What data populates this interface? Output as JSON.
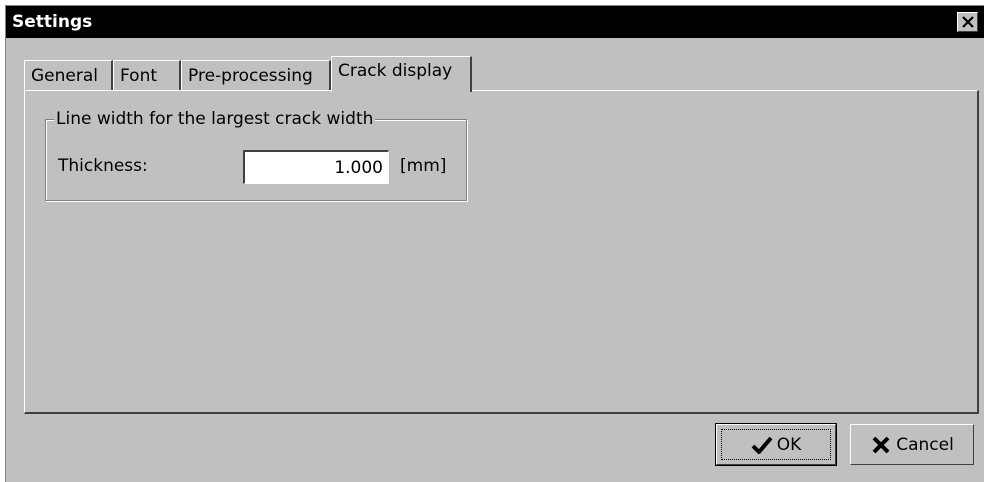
{
  "window": {
    "title": "Settings"
  },
  "tabs": [
    {
      "label": "General",
      "active": false
    },
    {
      "label": "Font",
      "active": false
    },
    {
      "label": "Pre-processing",
      "active": false
    },
    {
      "label": "Crack display",
      "active": true
    }
  ],
  "crack_display": {
    "group_title": "Line width for the largest crack width",
    "thickness_label": "Thickness:",
    "thickness_value": "1.000",
    "thickness_unit": "[mm]"
  },
  "buttons": {
    "ok_label": "OK",
    "ok_icon": "checkmark-icon",
    "cancel_label": "Cancel",
    "cancel_icon": "x-icon"
  },
  "colors": {
    "titlebar": "#000000",
    "face": "#c0c0c0"
  }
}
